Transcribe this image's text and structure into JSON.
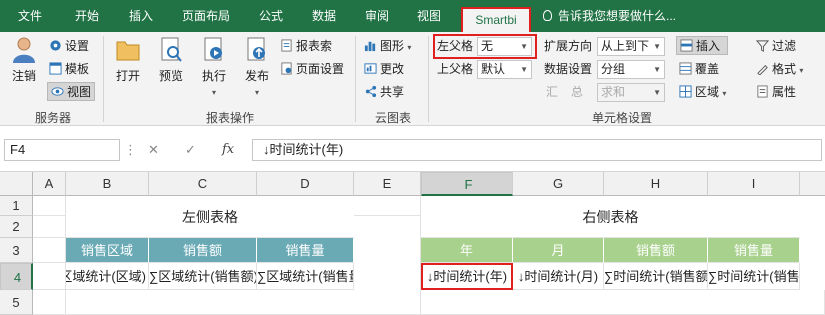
{
  "tabs": [
    "文件",
    "开始",
    "插入",
    "页面布局",
    "公式",
    "数据",
    "审阅",
    "视图",
    "Smartbi"
  ],
  "tell_me": "告诉我您想要做什么...",
  "ribbon": {
    "server": {
      "logout": "注销",
      "settings": "设置",
      "template": "模板",
      "view": "视图",
      "group_label": "服务器"
    },
    "report_ops": {
      "open": "打开",
      "preview": "预览",
      "execute": "执行",
      "publish": "发布",
      "report_query": "报表索",
      "page_setup": "页面设置",
      "group_label": "报表操作"
    },
    "cloud": {
      "chart": "图形",
      "change": "更改",
      "share": "共享",
      "group_label": "云图表"
    },
    "cell_settings": {
      "left_parent_label": "左父格",
      "left_parent_value": "无",
      "top_parent_label": "上父格",
      "top_parent_value": "默认",
      "expand_dir_label": "扩展方向",
      "expand_dir_value": "从上到下",
      "data_setting_label": "数据设置",
      "data_setting_value": "分组",
      "sum_label": "汇",
      "total_label": "总",
      "sum_value": "求和",
      "insert": "插入",
      "cover": "覆盖",
      "region": "区域",
      "filter": "过滤",
      "format": "格式",
      "attribute": "属性",
      "group_label": "单元格设置"
    }
  },
  "formula_bar": {
    "name_box": "F4",
    "fx": "fx",
    "formula": "↓时间统计(年)"
  },
  "grid": {
    "columns": [
      "A",
      "B",
      "C",
      "D",
      "E",
      "F",
      "G",
      "H",
      "I"
    ],
    "selected_column": "F",
    "rows": [
      "1",
      "2",
      "3",
      "4",
      "5"
    ],
    "selected_row": "4",
    "left_table": {
      "title": "左侧表格",
      "headers": [
        "销售区域",
        "销售额",
        "销售量"
      ],
      "cells": [
        "↓区域统计(区域)",
        "∑区域统计(销售额)",
        "∑区域统计(销售量)"
      ]
    },
    "right_table": {
      "title": "右侧表格",
      "headers": [
        "年",
        "月",
        "销售额",
        "销售量"
      ],
      "cells": [
        "↓时间统计(年)",
        "↓时间统计(月)",
        "∑时间统计(销售额)",
        "∑时间统计(销售量)"
      ]
    }
  },
  "colors": {
    "accent": "#217346",
    "highlight": "#e0201f",
    "header_teal": "#6aaab5",
    "header_green": "#a9d18e"
  }
}
